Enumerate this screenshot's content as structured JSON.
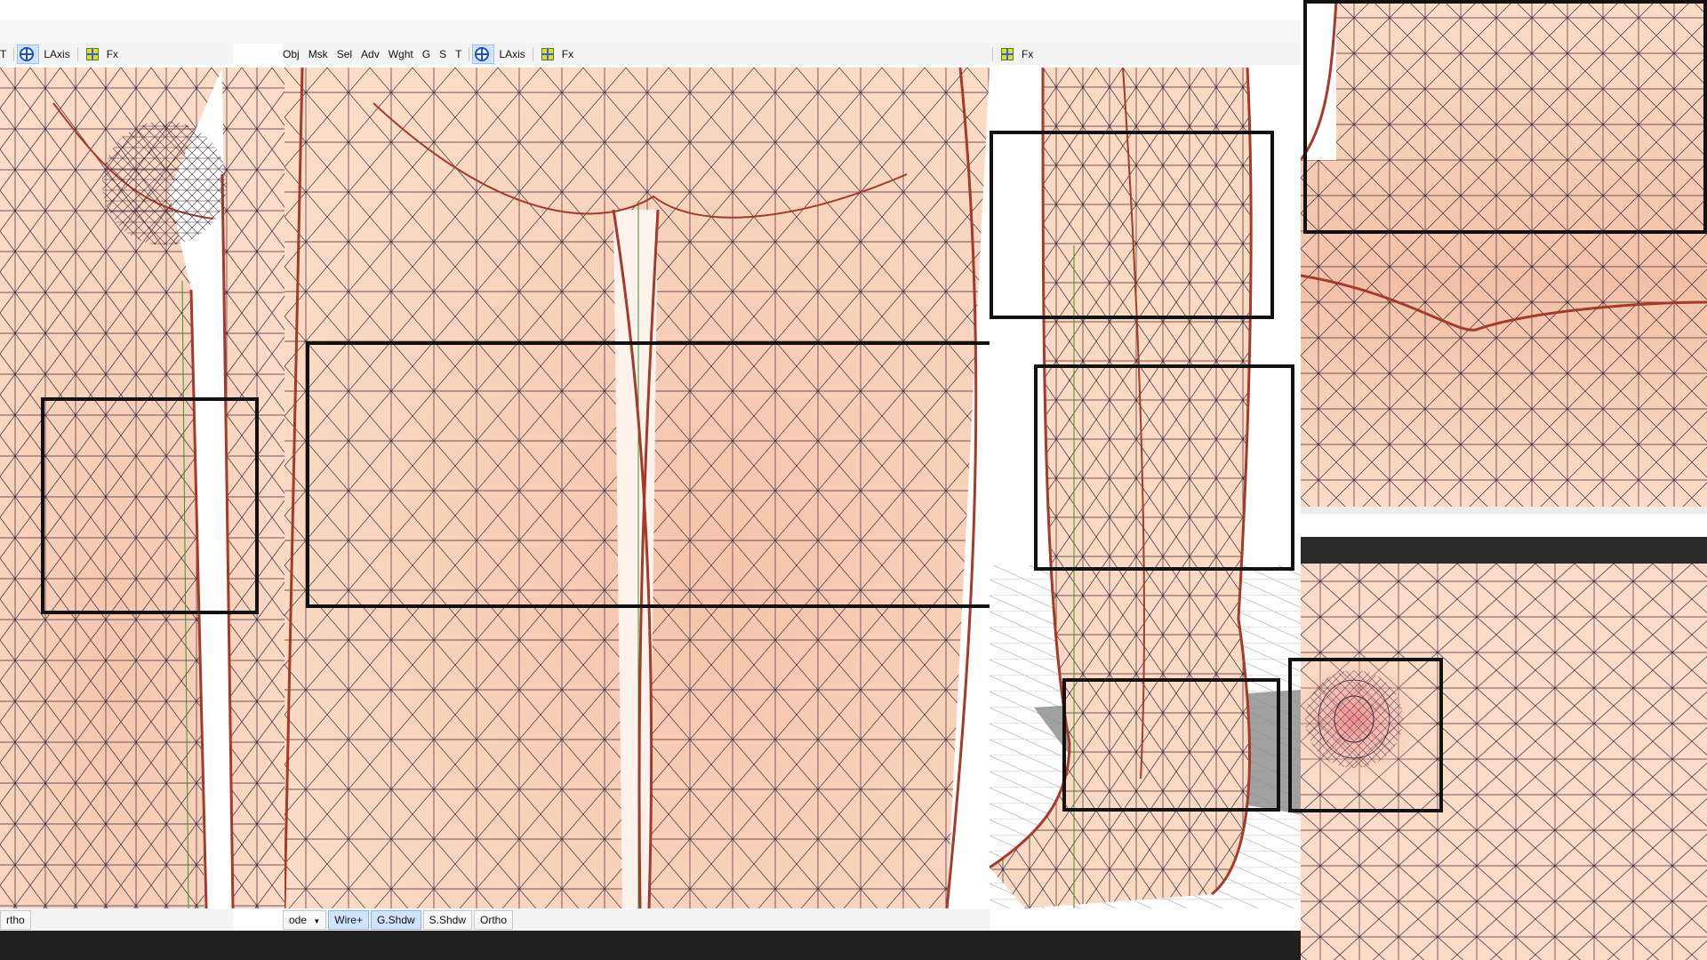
{
  "colors": {
    "skin": "#fcd9c2",
    "skin_dark": "#f4c6ad",
    "wire": "#3a2a3a",
    "outline": "#a33a2a",
    "frame": "#111111",
    "toolbar_bg": "#f3f3f3",
    "status_bar_bg": "#202020"
  },
  "left_panel": {
    "toolbar": {
      "t_label": "T",
      "laxis_label": "LAxis",
      "fx_label": "Fx"
    },
    "bottom": {
      "ortho_label": "rtho"
    }
  },
  "middle_panel": {
    "toolbar": {
      "obj_label": "Obj",
      "msk_label": "Msk",
      "sel_label": "Sel",
      "adv_label": "Adv",
      "wght_label": "Wght",
      "g_label": "G",
      "s_label": "S",
      "t_label": "T",
      "laxis_label": "LAxis",
      "fx_label": "Fx"
    },
    "bottom": {
      "mode_label": "ode",
      "wire_label": "Wire+",
      "gshdw_label": "G.Shdw",
      "sshdw_label": "S.Shdw",
      "ortho_label": "Ortho"
    }
  },
  "right_panel": {
    "toolbar": {
      "fx_label": "Fx"
    }
  },
  "icons": {
    "axis": "axis-crosshair-icon",
    "fx": "fx-grid-icon",
    "dropdown": "chevron-down-icon"
  }
}
